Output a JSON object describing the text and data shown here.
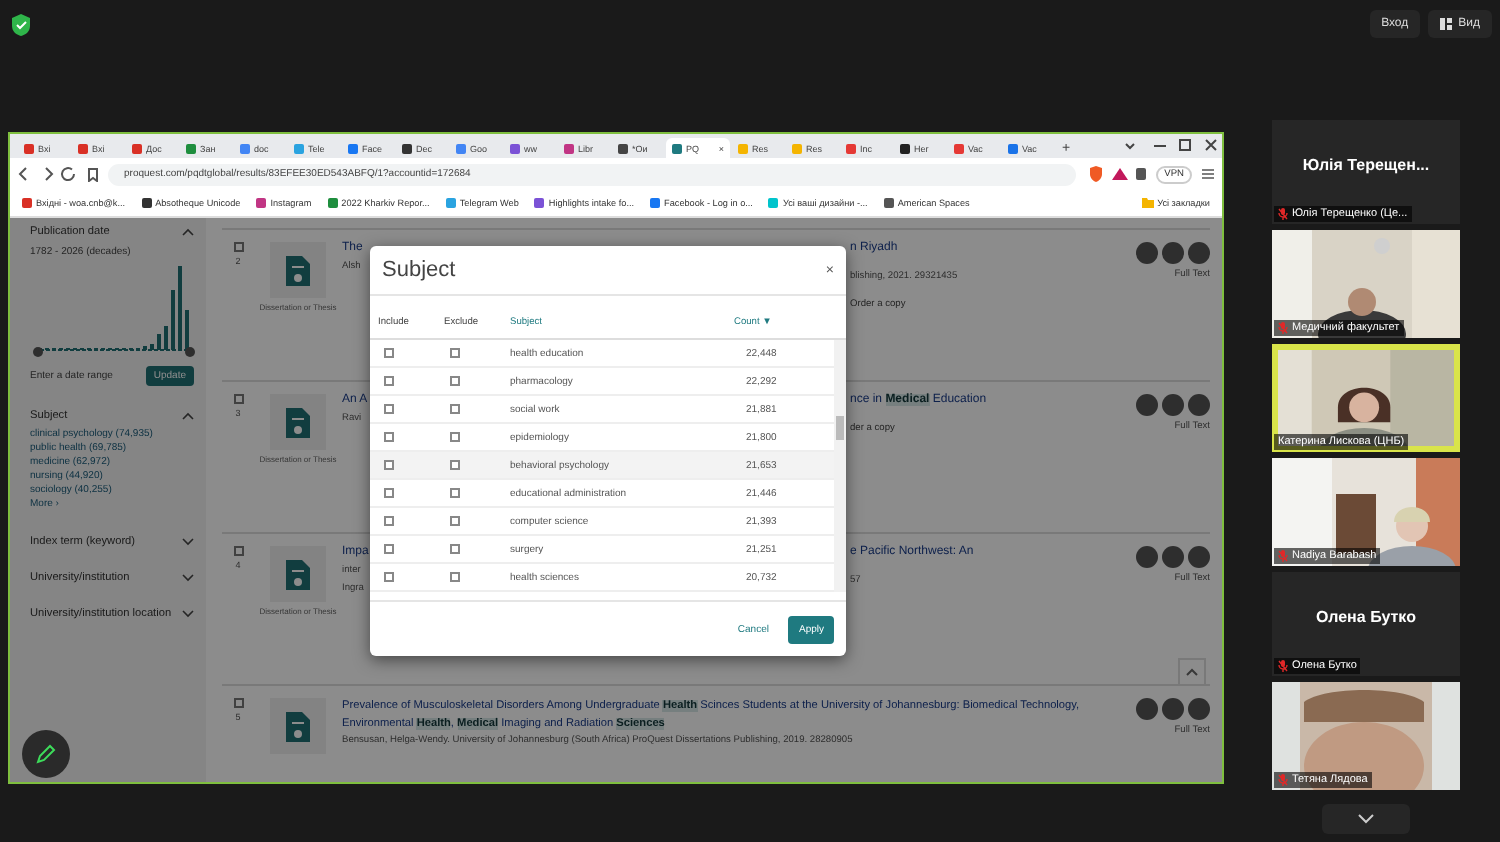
{
  "top_bar": {
    "buttons": [
      {
        "kind": "text",
        "label": "Вход"
      },
      {
        "kind": "view",
        "label": "Вид"
      }
    ]
  },
  "browser": {
    "tabs": [
      {
        "label": "Вхі",
        "selected": false,
        "color": "#d93025"
      },
      {
        "label": "Вхі",
        "selected": false,
        "color": "#d93025"
      },
      {
        "label": "Дос",
        "selected": false,
        "color": "#d93025"
      },
      {
        "label": "Зан",
        "selected": false,
        "color": "#1e8e3e"
      },
      {
        "label": "doc",
        "selected": false,
        "color": "#4285f4"
      },
      {
        "label": "Tele",
        "selected": false,
        "color": "#2aa3e0"
      },
      {
        "label": "Face",
        "selected": false,
        "color": "#1877f2"
      },
      {
        "label": "Dec",
        "selected": false,
        "color": "#333333"
      },
      {
        "label": "Goo",
        "selected": false,
        "color": "#4285f4"
      },
      {
        "label": "ww",
        "selected": false,
        "color": "#7b52d6"
      },
      {
        "label": "Libr",
        "selected": false,
        "color": "#c13584"
      },
      {
        "label": "*Ои",
        "selected": false,
        "color": "#444444"
      },
      {
        "label": "PQ",
        "selected": true,
        "color": "#1f7a80"
      },
      {
        "label": "Res",
        "selected": false,
        "color": "#f4b400"
      },
      {
        "label": "Res",
        "selected": false,
        "color": "#f4b400"
      },
      {
        "label": "Inc",
        "selected": false,
        "color": "#e53935"
      },
      {
        "label": "Her",
        "selected": false,
        "color": "#222222"
      },
      {
        "label": "Vac",
        "selected": false,
        "color": "#e53935"
      },
      {
        "label": "Vac",
        "selected": false,
        "color": "#1a73e8"
      }
    ],
    "new_tab": "+",
    "tab_close": "×",
    "url": "proquest.com/pqdtglobal/results/83EFEE30ED543ABFQ/1?accountid=172684",
    "vpn": "VPN",
    "bookmarks": [
      {
        "label": "Вхідні - woa.cnb@k...",
        "color": "#d93025"
      },
      {
        "label": "Absotheque Unicode",
        "color": "#333333"
      },
      {
        "label": "Instagram",
        "color": "#c13584"
      },
      {
        "label": "2022 Kharkiv Repor...",
        "color": "#1e8e3e"
      },
      {
        "label": "Telegram Web",
        "color": "#2aa3e0"
      },
      {
        "label": "Highlights intake fo...",
        "color": "#7b52d6"
      },
      {
        "label": "Facebook - Log in o...",
        "color": "#1877f2"
      },
      {
        "label": "Усі ваші дизайни -...",
        "color": "#00c4cc"
      },
      {
        "label": "American Spaces",
        "color": "#555555"
      }
    ],
    "all_bookmarks": "Усі закладки"
  },
  "sidebar": {
    "sections": [
      {
        "kind": "date",
        "title": "Publication date",
        "expanded": true,
        "range": "1782 - 2026 (decades)",
        "prompt": "Enter a date range",
        "button": "Update"
      },
      {
        "kind": "links",
        "title": "Subject",
        "expanded": true,
        "links": [
          "clinical psychology (74,935)",
          "public health (69,785)",
          "medicine (62,972)",
          "nursing (44,920)",
          "sociology (40,255)"
        ],
        "more": "More ›"
      },
      {
        "kind": "collapsed",
        "title": "Index term (keyword)",
        "expanded": false
      },
      {
        "kind": "collapsed",
        "title": "University/institution",
        "expanded": false
      },
      {
        "kind": "collapsed",
        "title": "University/institution location",
        "expanded": false
      }
    ]
  },
  "results": [
    {
      "kind": "split",
      "number": "2",
      "checked": false,
      "type_label": "Dissertation or Thesis",
      "left": [
        "The",
        "Alsh"
      ],
      "right": [
        {
          "kind": "title",
          "text": "n Riyadh"
        },
        {
          "kind": "meta",
          "text": "blishing, 2021. 29321435"
        },
        {
          "kind": "link",
          "text": "Order a copy"
        }
      ],
      "full_text": "Full Text"
    },
    {
      "kind": "split",
      "number": "3",
      "checked": false,
      "type_label": "Dissertation or Thesis",
      "left": [
        "An A",
        "Ravi"
      ],
      "right": [
        {
          "kind": "title",
          "text": "nce in **Medical** Education"
        },
        {
          "kind": "link",
          "text": "der a copy"
        }
      ],
      "full_text": "Full Text"
    },
    {
      "kind": "split",
      "number": "4",
      "checked": false,
      "type_label": "Dissertation or Thesis",
      "left": [
        "Impa",
        "inter",
        "Ingra"
      ],
      "right": [
        {
          "kind": "title",
          "text": "e Pacific Northwest: An"
        },
        {
          "kind": "meta",
          "text": "57"
        }
      ],
      "full_text": "Full Text"
    },
    {
      "kind": "full",
      "number": "5",
      "checked": false,
      "title": "Prevalence of Musculoskeletal Disorders Among Undergraduate **Health** Scinces Students at the University of Johannesburg: Biomedical Technology, Environmental **Health**, **Medical** Imaging and Radiation **Sciences**",
      "author": "Bensusan, Helga-Wendy.  University of Johannesburg (South Africa) ProQuest Dissertations Publishing, 2019. 28280905",
      "full_text": "Full Text"
    }
  ],
  "modal": {
    "title": "Subject",
    "close": "×",
    "columns": [
      "Include",
      "Exclude",
      "Subject",
      "Count"
    ],
    "sort_mark": "▼",
    "rows": [
      {
        "subject": "health education",
        "count": "22,448",
        "include": false,
        "exclude": false,
        "highlighted": false
      },
      {
        "subject": "pharmacology",
        "count": "22,292",
        "include": false,
        "exclude": false,
        "highlighted": false
      },
      {
        "subject": "social work",
        "count": "21,881",
        "include": false,
        "exclude": false,
        "highlighted": false
      },
      {
        "subject": "epidemiology",
        "count": "21,800",
        "include": false,
        "exclude": false,
        "highlighted": false
      },
      {
        "subject": "behavioral psychology",
        "count": "21,653",
        "include": false,
        "exclude": false,
        "highlighted": true
      },
      {
        "subject": "educational administration",
        "count": "21,446",
        "include": false,
        "exclude": false,
        "highlighted": false
      },
      {
        "subject": "computer science",
        "count": "21,393",
        "include": false,
        "exclude": false,
        "highlighted": false
      },
      {
        "subject": "surgery",
        "count": "21,251",
        "include": false,
        "exclude": false,
        "highlighted": false
      },
      {
        "subject": "health sciences",
        "count": "20,732",
        "include": false,
        "exclude": false,
        "highlighted": false
      }
    ],
    "cancel": "Cancel",
    "apply": "Apply"
  },
  "participants": [
    {
      "kind": "name",
      "display": "Юлія  Терещен...",
      "label": "Юлія Терещенко (Це...",
      "muted": true,
      "speaking": false
    },
    {
      "kind": "video",
      "label": "Медичний факультет",
      "muted": true,
      "speaking": false
    },
    {
      "kind": "video",
      "label": "Катерина Лискова (ЦНБ)",
      "muted": false,
      "speaking": true
    },
    {
      "kind": "video",
      "label": "Nadiya Barabash",
      "muted": true,
      "speaking": false
    },
    {
      "kind": "name",
      "display": "Олена Бутко",
      "label": "Олена Бутко",
      "muted": true,
      "speaking": false
    },
    {
      "kind": "video",
      "label": "Тетяна Лядова",
      "muted": true,
      "speaking": false
    }
  ]
}
